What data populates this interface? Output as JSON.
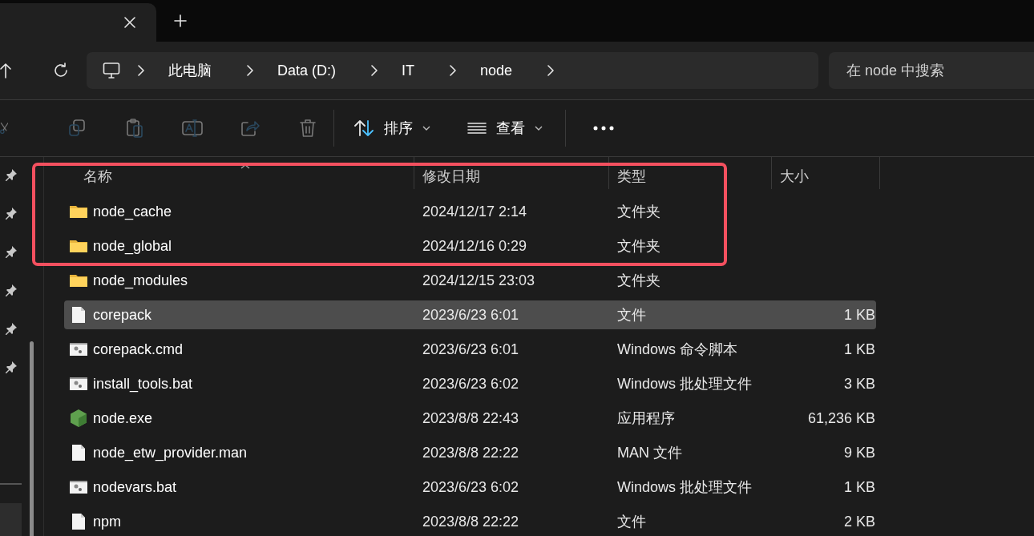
{
  "tabs": [
    {
      "selected": true
    }
  ],
  "breadcrumb": [
    "此电脑",
    "Data (D:)",
    "IT",
    "node"
  ],
  "search": {
    "placeholder": "在 node 中搜索"
  },
  "toolbar": {
    "actions": [
      {
        "kind": "cut",
        "disabled": true
      },
      {
        "kind": "copy",
        "disabled": true
      },
      {
        "kind": "paste",
        "disabled": true
      },
      {
        "kind": "rename",
        "disabled": true
      },
      {
        "kind": "share",
        "disabled": true
      },
      {
        "kind": "delete",
        "disabled": true
      }
    ],
    "sort": {
      "label": "排序"
    },
    "view": {
      "label": "查看"
    }
  },
  "columns": [
    {
      "label": "名称",
      "sorted": true
    },
    {
      "label": "修改日期",
      "sorted": false
    },
    {
      "label": "类型",
      "sorted": false
    },
    {
      "label": "大小",
      "sorted": false
    }
  ],
  "rows": [
    {
      "kind": "folder",
      "name": "node_cache",
      "modified": "2024/12/17 2:14",
      "type": "文件夹",
      "selected": false,
      "annotated": true
    },
    {
      "kind": "folder",
      "name": "node_global",
      "modified": "2024/12/16 0:29",
      "type": "文件夹",
      "selected": false,
      "annotated": true
    },
    {
      "kind": "folder",
      "name": "node_modules",
      "modified": "2024/12/15 23:03",
      "type": "文件夹",
      "selected": false,
      "annotated": false
    },
    {
      "kind": "file",
      "name": "corepack",
      "modified": "2023/6/23 6:01",
      "type": "文件",
      "size": "1 KB",
      "selected": true,
      "annotated": false
    },
    {
      "kind": "script",
      "name": "corepack.cmd",
      "modified": "2023/6/23 6:01",
      "type": "Windows 命令脚本",
      "size": "1 KB",
      "selected": false,
      "annotated": false
    },
    {
      "kind": "script",
      "name": "install_tools.bat",
      "modified": "2023/6/23 6:02",
      "type": "Windows 批处理文件",
      "size": "3 KB",
      "selected": false,
      "annotated": false
    },
    {
      "kind": "app",
      "name": "node.exe",
      "modified": "2023/8/8 22:43",
      "type": "应用程序",
      "size": "61,236 KB",
      "selected": false,
      "annotated": false
    },
    {
      "kind": "file",
      "name": "node_etw_provider.man",
      "modified": "2023/8/8 22:22",
      "type": "MAN 文件",
      "size": "9 KB",
      "selected": false,
      "annotated": false
    },
    {
      "kind": "script",
      "name": "nodevars.bat",
      "modified": "2023/6/23 6:02",
      "type": "Windows 批处理文件",
      "size": "1 KB",
      "selected": false,
      "annotated": false
    },
    {
      "kind": "file",
      "name": "npm",
      "modified": "2023/8/8 22:22",
      "type": "文件",
      "size": "2 KB",
      "selected": false,
      "annotated": false
    }
  ]
}
